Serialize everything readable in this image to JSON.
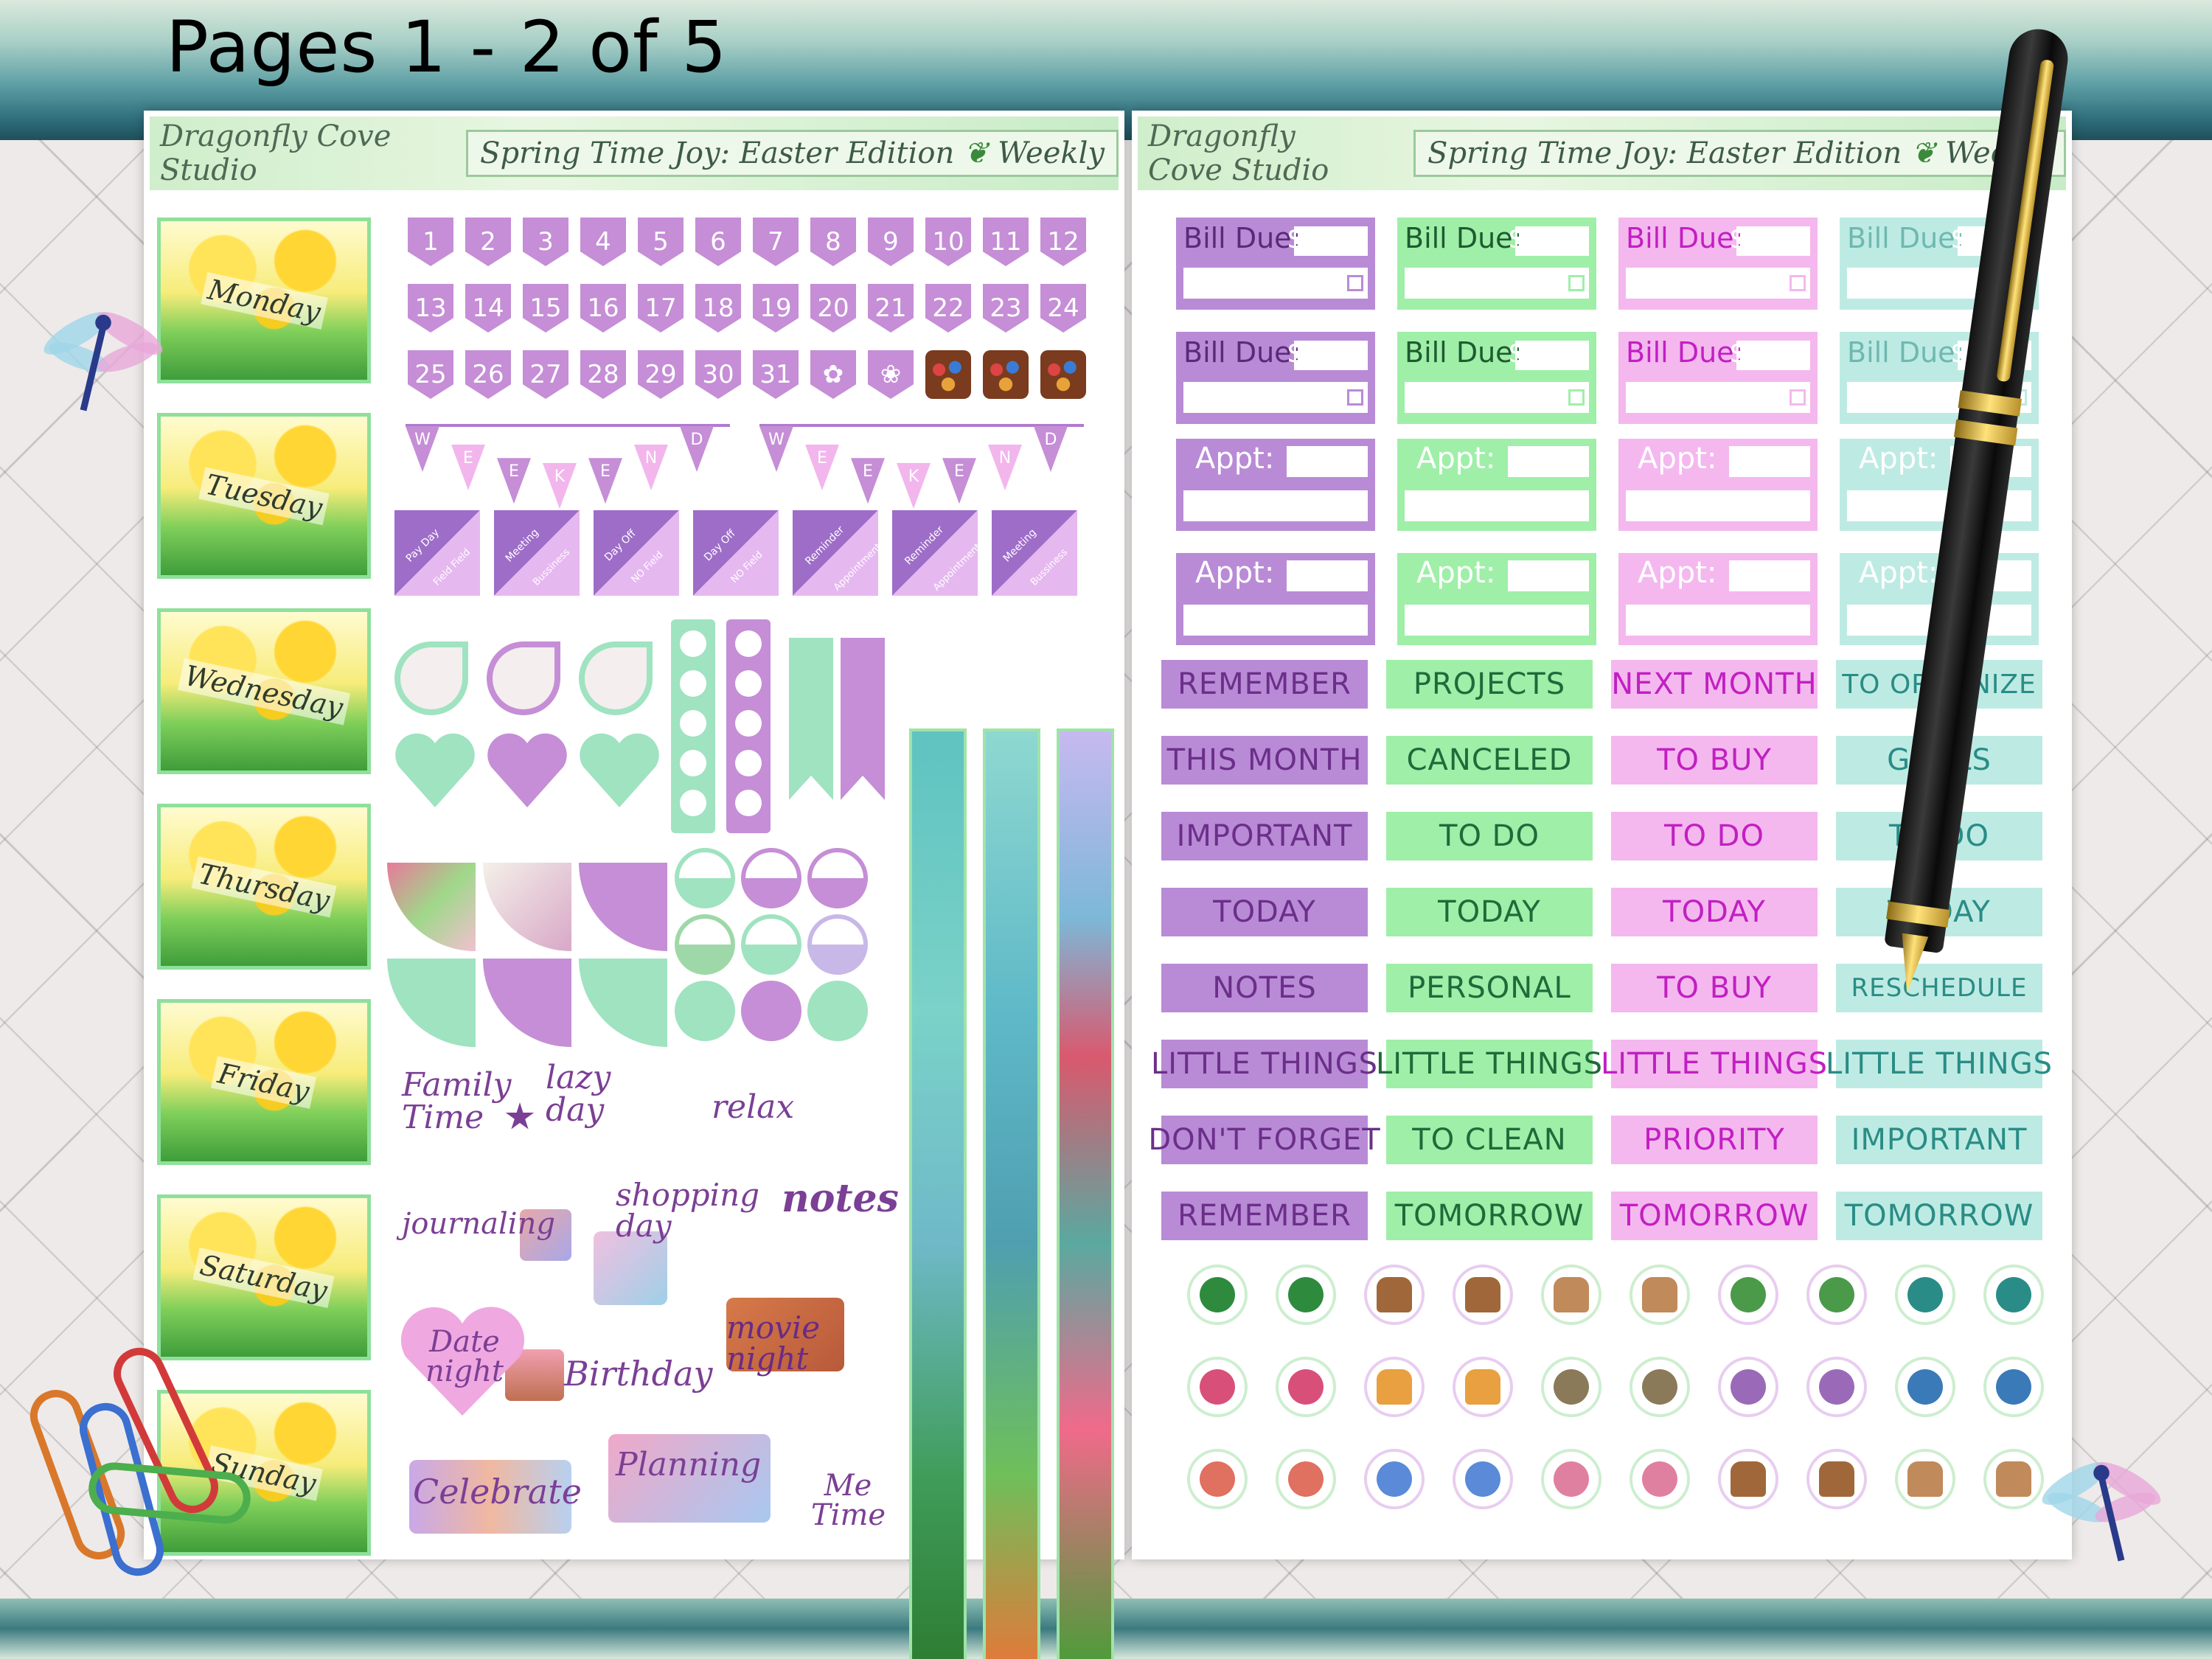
{
  "page_count": "Pages 1 - 2 of 5",
  "header": {
    "studio": "Dragonfly Cove Studio",
    "edition": "Spring Time Joy: Easter Edition",
    "hearts": "❦",
    "weekly": "Weekly"
  },
  "days": [
    "Monday",
    "Tuesday",
    "Wednesday",
    "Thursday",
    "Friday",
    "Saturday",
    "Sunday"
  ],
  "numbers": [
    "1",
    "2",
    "3",
    "4",
    "5",
    "6",
    "7",
    "8",
    "9",
    "10",
    "11",
    "12",
    "13",
    "14",
    "15",
    "16",
    "17",
    "18",
    "19",
    "20",
    "21",
    "22",
    "23",
    "24",
    "25",
    "26",
    "27",
    "28",
    "29",
    "30",
    "31"
  ],
  "weekend": [
    "W",
    "E",
    "E",
    "K",
    "E",
    "N",
    "D"
  ],
  "diagonal_tabs": [
    {
      "top": "Pay Day",
      "bottom": "Field Field"
    },
    {
      "top": "Meeting",
      "bottom": "Bussiness"
    },
    {
      "top": "Day Off",
      "bottom": "NO Field"
    },
    {
      "top": "Day Off",
      "bottom": "NO Field"
    },
    {
      "top": "Reminder",
      "bottom": "Appointment"
    },
    {
      "top": "Reminder",
      "bottom": "Appointment"
    },
    {
      "top": "Meeting",
      "bottom": "Bussiness"
    }
  ],
  "scripts": {
    "family_time": "Family Time",
    "lazy_day": "lazy day",
    "relax": "relax",
    "journaling": "journaling",
    "shopping_day": "shopping day",
    "notes": "notes",
    "date_night": "Date night",
    "birthday": "Birthday",
    "movie_night": "movie night",
    "celebrate": "Celebrate",
    "planning": "Planning",
    "me_time": "Me Time"
  },
  "bill_label": "Bill Due:",
  "dollar": "$",
  "appt_label": "Appt:",
  "word_columns": [
    [
      "REMEMBER",
      "THIS MONTH",
      "IMPORTANT",
      "TODAY",
      "NOTES",
      "LITTLE THINGS",
      "DON'T FORGET",
      "REMEMBER"
    ],
    [
      "PROJECTS",
      "CANCELED",
      "TO DO",
      "TODAY",
      "PERSONAL",
      "LITTLE THINGS",
      "TO CLEAN",
      "TOMORROW"
    ],
    [
      "NEXT MONTH",
      "TO BUY",
      "TO DO",
      "TODAY",
      "TO BUY",
      "LITTLE THINGS",
      "PRIORITY",
      "TOMORROW"
    ],
    [
      "TO ORGANIZE",
      "GOALS",
      "TO DO",
      "TODAY",
      "RESCHEDULE",
      "LITTLE THINGS",
      "IMPORTANT",
      "TOMORROW"
    ]
  ],
  "colors": {
    "purple": "#b98bd6",
    "purple_text": "#6b2f8a",
    "green": "#9fefa8",
    "green_text": "#1e6b3a",
    "pink": "#f4b8ef",
    "pink_text": "#c21fc2",
    "teal": "#bdebe3",
    "teal_text": "#2a8c86"
  },
  "icons": [
    [
      "trash-bin-icon",
      "trash-bin-icon",
      "basket-icon",
      "basket-icon",
      "grocery-bag-icon",
      "grocery-bag-icon",
      "kettlebell-icon",
      "kettlebell-icon",
      "stethoscope-icon",
      "stethoscope-icon"
    ],
    [
      "birthday-cake-icon",
      "birthday-cake-icon",
      "shopping-bags-icon",
      "shopping-bags-icon",
      "notebook-icon",
      "notebook-icon",
      "tools-icon",
      "tools-icon",
      "scissors-icon",
      "scissors-icon"
    ],
    [
      "manicure-icon",
      "manicure-icon",
      "gem-icon",
      "gem-icon",
      "cupcake-icon",
      "cupcake-icon",
      "basket-icon",
      "basket-icon",
      "grocery-bag-icon",
      "grocery-bag-icon"
    ]
  ]
}
